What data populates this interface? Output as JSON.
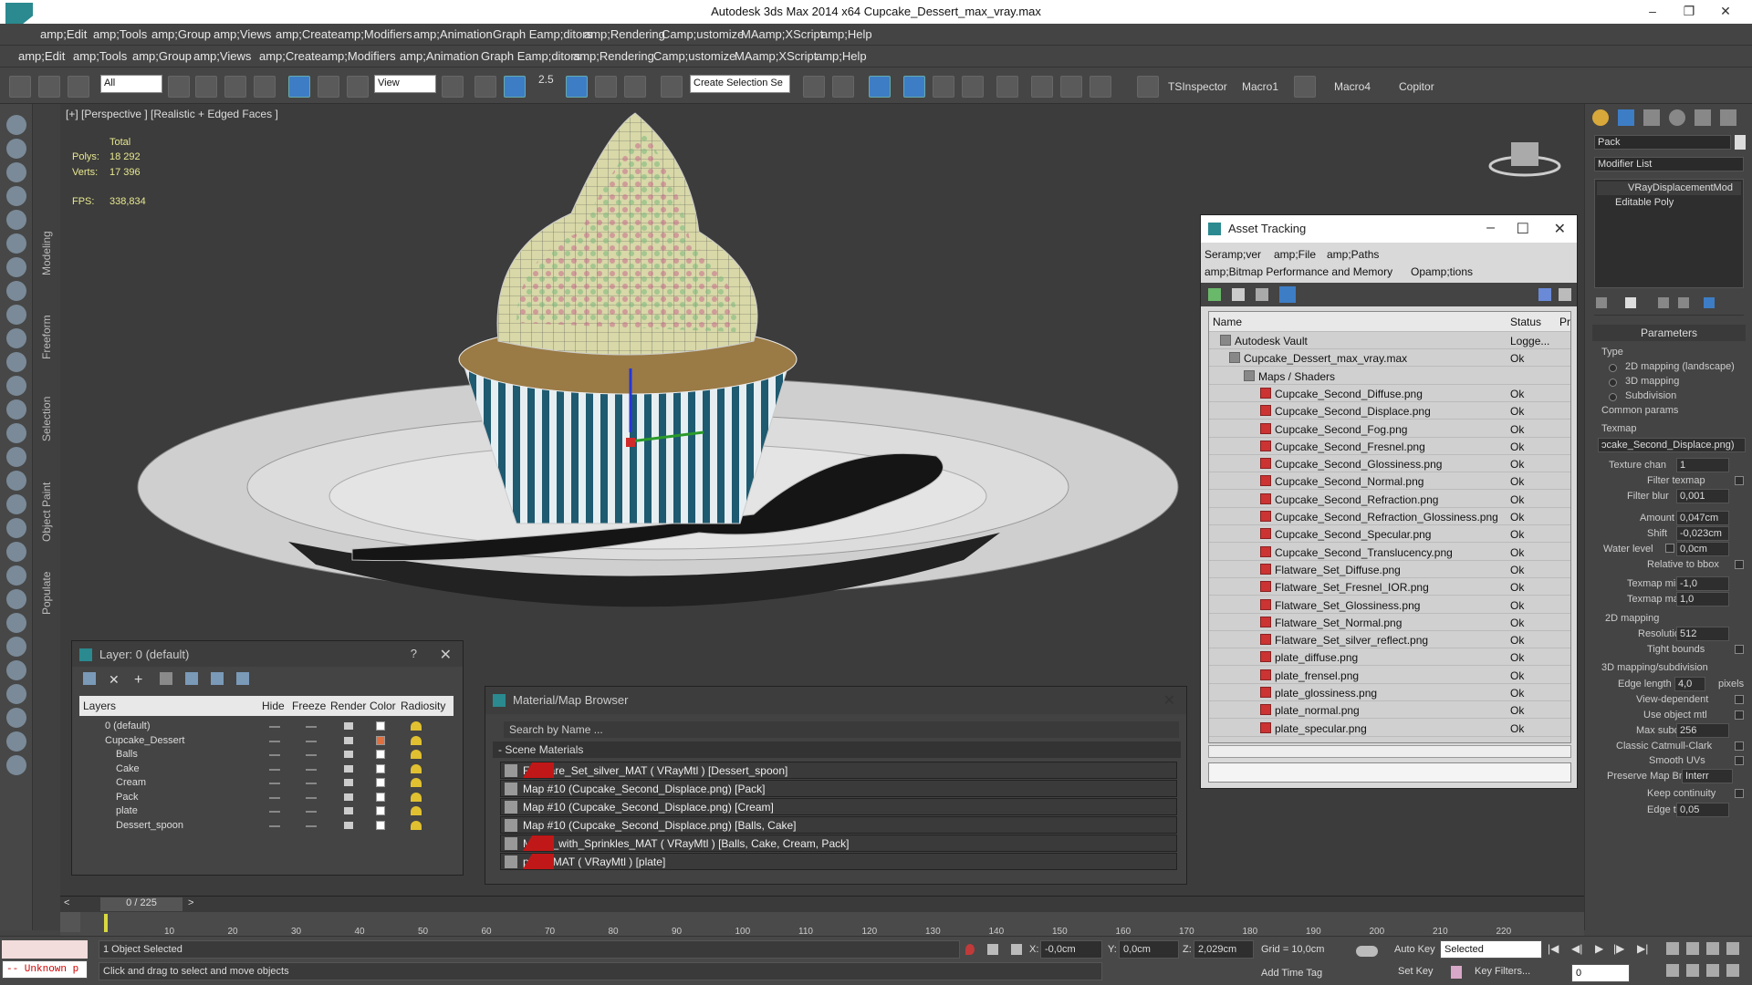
{
  "window": {
    "title": "Autodesk 3ds Max  2014 x64      Cupcake_Dessert_max_vray.max"
  },
  "menu1": [
    "amp;Edit",
    "amp;Tools",
    "amp;Group",
    "amp;Views",
    "amp;Create",
    "amp;Modifiers",
    "amp;Animation",
    "Graph Eamp;ditors",
    "amp;Rendering",
    "Camp;ustomize",
    "MAamp;XScript",
    "amp;Help"
  ],
  "menu2": [
    "amp;Edit",
    "amp;Tools",
    "amp;Group",
    "amp;Views",
    "amp;Create",
    "amp;Modifiers",
    "amp;Animation",
    "Graph Eamp;ditors",
    "amp;Rendering",
    "Camp;ustomize",
    "MAamp;XScript",
    "amp;Help"
  ],
  "toolbar": {
    "filter": "All",
    "refcoord": "View",
    "snap_value": "2.5",
    "selset": "Create Selection Se",
    "tsinspector": "TSInspector",
    "macro1": "Macro1",
    "macro4": "Macro4",
    "copitor": "Copitor"
  },
  "ribbon": {
    "tabs": [
      "Modeling",
      "Freeform",
      "Selection",
      "Object Paint",
      "Populate"
    ]
  },
  "viewport": {
    "label": "[+] [Perspective ] [Realistic + Edged Faces ]",
    "total": "Total",
    "polys_label": "Polys:",
    "polys": "18 292",
    "verts_label": "Verts:",
    "verts": "17 396",
    "fps_label": "FPS:",
    "fps": "338,834"
  },
  "layer": {
    "title": "Layer: 0 (default)",
    "q": "?",
    "headers": {
      "layers": "Layers",
      "hide": "Hide",
      "freeze": "Freeze",
      "render": "Render",
      "color": "Color",
      "radiosity": "Radiosity"
    },
    "rows": [
      {
        "name": "0 (default)",
        "color": "#ffffff"
      },
      {
        "name": "Cupcake_Dessert",
        "color": "#e07040"
      },
      {
        "name": "Balls",
        "color": "#ffffff"
      },
      {
        "name": "Cake",
        "color": "#ffffff"
      },
      {
        "name": "Cream",
        "color": "#ffffff"
      },
      {
        "name": "Pack",
        "color": "#ffffff"
      },
      {
        "name": "plate",
        "color": "#ffffff"
      },
      {
        "name": "Dessert_spoon",
        "color": "#ffffff"
      }
    ]
  },
  "matbrowser": {
    "title": "Material/Map Browser",
    "search": "Search by Name ...",
    "section": "- Scene Materials",
    "rows": [
      {
        "text": "Flatware_Set_silver_MAT  ( VRayMtl )  [Dessert_spoon]",
        "red": true
      },
      {
        "text": "Map #10 (Cupcake_Second_Displace.png)  [Pack]",
        "red": false
      },
      {
        "text": "Map #10 (Cupcake_Second_Displace.png)  [Cream]",
        "red": false
      },
      {
        "text": "Map #10 (Cupcake_Second_Displace.png)  [Balls, Cake]",
        "red": false
      },
      {
        "text": "Muffin_with_Sprinkles_MAT  ( VRayMtl )  [Balls, Cake, Cream, Pack]",
        "red": true
      },
      {
        "text": "plate_MAT  ( VRayMtl )  [plate]",
        "red": true
      }
    ]
  },
  "asset": {
    "title": "Asset Tracking",
    "menu": [
      "Seramp;ver",
      "amp;File",
      "amp;Paths",
      "amp;Bitmap Performance and Memory",
      "Opamp;tions"
    ],
    "headers": {
      "name": "Name",
      "status": "Status",
      "pr": "Pr"
    },
    "rows": [
      {
        "name": "Autodesk Vault",
        "status": "Logge...",
        "indent": 0,
        "kind": "vault"
      },
      {
        "name": "Cupcake_Dessert_max_vray.max",
        "status": "Ok",
        "indent": 1,
        "kind": "max"
      },
      {
        "name": "Maps / Shaders",
        "status": "",
        "indent": 2,
        "kind": "folder"
      },
      {
        "name": "Cupcake_Second_Diffuse.png",
        "status": "Ok",
        "indent": 3,
        "kind": "png"
      },
      {
        "name": "Cupcake_Second_Displace.png",
        "status": "Ok",
        "indent": 3,
        "kind": "png"
      },
      {
        "name": "Cupcake_Second_Fog.png",
        "status": "Ok",
        "indent": 3,
        "kind": "png"
      },
      {
        "name": "Cupcake_Second_Fresnel.png",
        "status": "Ok",
        "indent": 3,
        "kind": "png"
      },
      {
        "name": "Cupcake_Second_Glossiness.png",
        "status": "Ok",
        "indent": 3,
        "kind": "png"
      },
      {
        "name": "Cupcake_Second_Normal.png",
        "status": "Ok",
        "indent": 3,
        "kind": "png"
      },
      {
        "name": "Cupcake_Second_Refraction.png",
        "status": "Ok",
        "indent": 3,
        "kind": "png"
      },
      {
        "name": "Cupcake_Second_Refraction_Glossiness.png",
        "status": "Ok",
        "indent": 3,
        "kind": "png"
      },
      {
        "name": "Cupcake_Second_Specular.png",
        "status": "Ok",
        "indent": 3,
        "kind": "png"
      },
      {
        "name": "Cupcake_Second_Translucency.png",
        "status": "Ok",
        "indent": 3,
        "kind": "png"
      },
      {
        "name": "Flatware_Set_Diffuse.png",
        "status": "Ok",
        "indent": 3,
        "kind": "png"
      },
      {
        "name": "Flatware_Set_Fresnel_IOR.png",
        "status": "Ok",
        "indent": 3,
        "kind": "png"
      },
      {
        "name": "Flatware_Set_Glossiness.png",
        "status": "Ok",
        "indent": 3,
        "kind": "png"
      },
      {
        "name": "Flatware_Set_Normal.png",
        "status": "Ok",
        "indent": 3,
        "kind": "png"
      },
      {
        "name": "Flatware_Set_silver_reflect.png",
        "status": "Ok",
        "indent": 3,
        "kind": "png"
      },
      {
        "name": "plate_diffuse.png",
        "status": "Ok",
        "indent": 3,
        "kind": "png"
      },
      {
        "name": "plate_frensel.png",
        "status": "Ok",
        "indent": 3,
        "kind": "png"
      },
      {
        "name": "plate_glossiness.png",
        "status": "Ok",
        "indent": 3,
        "kind": "png"
      },
      {
        "name": "plate_normal.png",
        "status": "Ok",
        "indent": 3,
        "kind": "png"
      },
      {
        "name": "plate_specular.png",
        "status": "Ok",
        "indent": 3,
        "kind": "png"
      }
    ]
  },
  "cmd": {
    "object_name": "Pack",
    "modifier_list": "Modifier List",
    "stack": [
      "VRayDisplacementMod",
      "Editable Poly"
    ],
    "rollout": "Parameters",
    "type_label": "Type",
    "type_options": [
      "2D mapping (landscape)",
      "3D mapping",
      "Subdivision"
    ],
    "common": "Common params",
    "texmap": "Texmap",
    "texmap_value": "ɔcake_Second_Displace.png)",
    "texture_chan": "Texture chan",
    "texture_chan_v": "1",
    "filter_texmap": "Filter texmap",
    "filter_blur": "Filter blur",
    "filter_blur_v": "0,001",
    "amount": "Amount",
    "amount_v": "0,047cm",
    "shift": "Shift",
    "shift_v": "-0,023cm",
    "water": "Water level",
    "water_v": "0,0cm",
    "relbbox": "Relative to bbox",
    "texmin": "Texmap min",
    "texmin_v": "-1,0",
    "texmax": "Texmap max",
    "texmax_v": "1,0",
    "map2d": "2D mapping",
    "resolution": "Resolution",
    "resolution_v": "512",
    "tight": "Tight bounds",
    "map3d": "3D mapping/subdivision",
    "edge": "Edge length",
    "edge_v": "4,0",
    "pixels": "pixels",
    "viewdep": "View-dependent",
    "useobj": "Use object mtl",
    "maxsub": "Max subdivs",
    "maxsub_v": "256",
    "catmull": "Classic Catmull-Clark",
    "smoothuv": "Smooth UVs",
    "preserve": "Preserve Map Bnd",
    "preserve_v": "Interr",
    "keepcont": "Keep continuity",
    "edgethresh": "Edge thresh",
    "edgethresh_v": "0,05"
  },
  "timeline": {
    "frame": "0 / 225",
    "ticks": [
      "0",
      "10",
      "20",
      "30",
      "40",
      "50",
      "60",
      "70",
      "80",
      "90",
      "100",
      "110",
      "120",
      "130",
      "140",
      "150",
      "160",
      "170",
      "180",
      "190",
      "200",
      "210",
      "220"
    ]
  },
  "status": {
    "maxscript": "-- Unknown p",
    "selected": "1 Object Selected",
    "prompt": "Click and drag to select and move objects",
    "x_label": "X:",
    "x": "-0,0cm",
    "y_label": "Y:",
    "y": "0,0cm",
    "z_label": "Z:",
    "z": "2,029cm",
    "grid": "Grid = 10,0cm",
    "autokey": "Auto Key",
    "setkey": "Set Key",
    "selected_mode": "Selected",
    "keyfilters": "Key Filters...",
    "addtimetag": "Add Time Tag",
    "frame_field": "0"
  }
}
